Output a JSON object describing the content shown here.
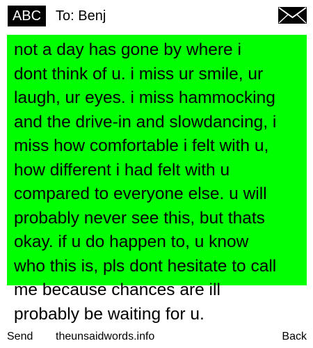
{
  "header": {
    "input_mode": "ABC",
    "recipient": "To: Benj",
    "message_icon": "envelope-icon"
  },
  "message": {
    "highlight_color": "#00ff00",
    "lines": [
      "not a day has gone by where i",
      "dont think of u. i miss ur smile, ur",
      "laugh, ur eyes. i miss hammocking",
      "and the drive-in and slowdancing, i",
      "miss how comfortable i felt with u,",
      "how different i had felt with u",
      "compared to everyone else. u will",
      "probably never see this, but thats",
      "okay. if u do happen to, u know",
      "who this is, pls dont hesitate to call",
      "me because chances are ill",
      "probably be waiting for u."
    ]
  },
  "softkeys": {
    "left": "Send",
    "center": "theunsaidwords.info",
    "right": "Back"
  }
}
